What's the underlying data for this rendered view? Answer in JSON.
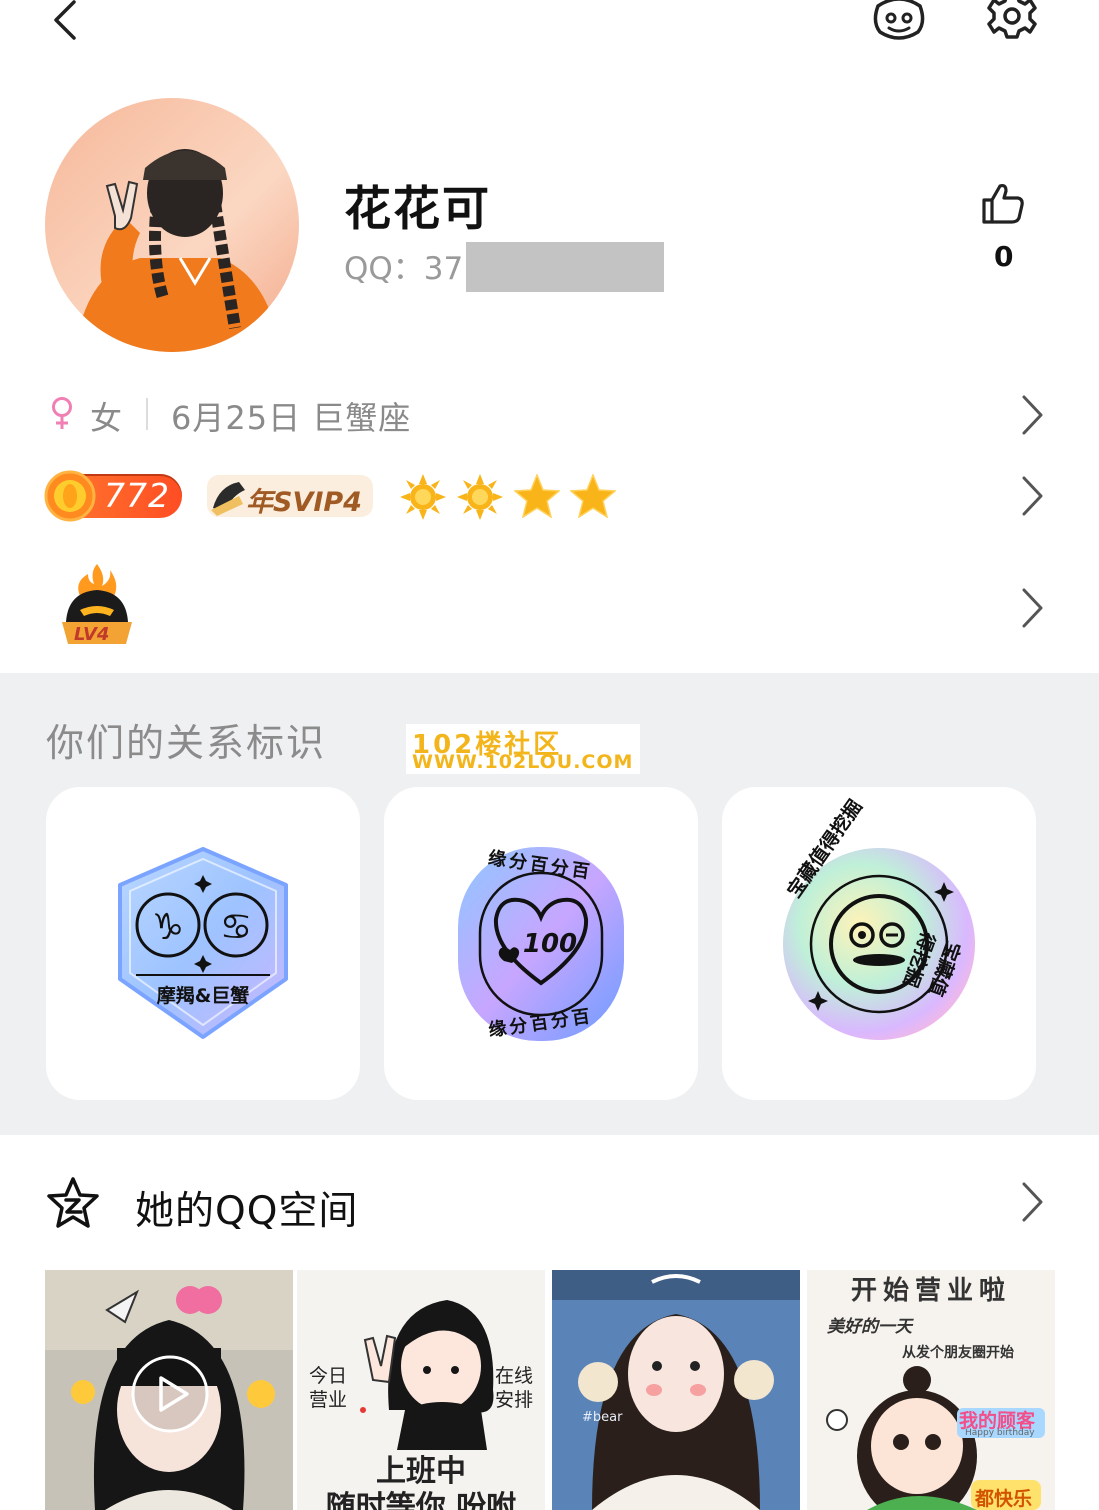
{
  "profile": {
    "nickname": "花花可",
    "qq_label": "QQ：37",
    "likes": "0"
  },
  "info": {
    "gender": "女",
    "birthday": "6月25日 巨蟹座"
  },
  "badges": {
    "level": "772",
    "svip": "年SVIP4",
    "rank_icons": [
      "sun-icon",
      "sun-icon",
      "star-icon",
      "star-icon"
    ],
    "lv4": "LV4"
  },
  "relationship": {
    "title": "你们的关系标识",
    "watermark_line1": "102楼社区",
    "watermark_line2": "WWW.102LOU.COM",
    "cards": [
      {
        "text": "摩羯&巨蟹",
        "icon": "capricorn-cancer-badge-icon"
      },
      {
        "top": "缘分百分百",
        "number": "100",
        "bottom": "缘分百分百",
        "icon": "heart-100-badge-icon"
      },
      {
        "text_left": "宝藏值得挖掘",
        "text_right": "宝藏值得挖掘",
        "icon": "treasure-face-badge-icon"
      }
    ]
  },
  "qzone": {
    "title": "她的QQ空间",
    "photo2_left": "今日\n营业",
    "photo2_left_1": "今日",
    "photo2_left_2": "营业",
    "photo2_right_1": "在线",
    "photo2_right_2": "安排",
    "photo2_bottom_1": "上班中",
    "photo2_bottom_2": "随时等你 吩咐",
    "photo3_tag": "#bear",
    "photo4_title": "开始营业啦",
    "photo4_line1": "美好的一天",
    "photo4_line2": "从发个朋友圈开始",
    "photo4_stamp": "我的顾客",
    "photo4_stamp_sub": "Happy birthday",
    "photo4_bottom": "都快乐"
  },
  "colors": {
    "level_orange": "#ff5a26",
    "svip_brown": "#a05a24",
    "female_pink": "#f07fb4",
    "band_gray": "#eff0f2",
    "watermark_yellow": "#f3b51c"
  }
}
